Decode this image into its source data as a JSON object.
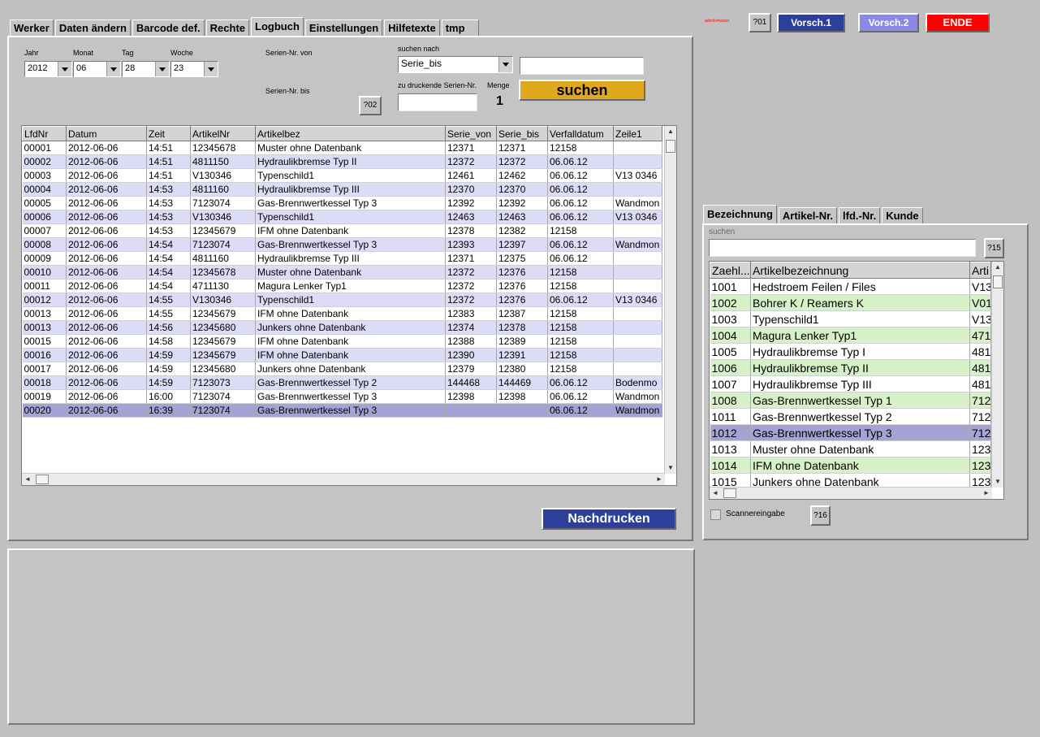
{
  "main_tabs": [
    "Werker",
    "Daten ändern",
    "Barcode def.",
    "Rechte",
    "Logbuch",
    "Einstellungen",
    "Hilfetexte",
    "tmp"
  ],
  "active_main_tab": "Logbuch",
  "top_bar": {
    "tiny_text": "admin/master",
    "btn_q01": "?01",
    "btn_vorsch1": "Vorsch.1",
    "btn_vorsch2": "Vorsch.2",
    "btn_ende": "ENDE"
  },
  "colors": {
    "vorsch1_bg": "#2c3f9a",
    "vorsch2_bg": "#8a8ae6",
    "ende_bg": "#ff0000",
    "suchen_bg": "#e0a81c",
    "nachdrucken_bg": "#2c3f9a",
    "row_alt_log": "#dcdcf6",
    "row_selected": "#a4a4d4",
    "row_alt_right": "#d6f0c8"
  },
  "date_filter": {
    "jahr_label": "Jahr",
    "jahr_value": "2012",
    "monat_label": "Monat",
    "monat_value": "06",
    "tag_label": "Tag",
    "tag_value": "28",
    "woche_label": "Woche",
    "woche_value": "23"
  },
  "search": {
    "serien_von_label": "Serien-Nr. von",
    "serien_bis_label": "Serien-Nr. bis",
    "btn_q02": "?02",
    "suchen_nach_label": "suchen nach",
    "suchen_nach_value": "Serie_bis",
    "search_value": "",
    "zu_druckende_label": "zu druckende Serien-Nr.",
    "zu_druckende_value": "",
    "menge_label": "Menge",
    "menge_value": "1",
    "suchen_button": "suchen"
  },
  "log_table": {
    "columns": [
      "LfdNr",
      "Datum",
      "Zeit",
      "ArtikelNr",
      "Artikelbez",
      "Serie_von",
      "Serie_bis",
      "Verfalldatum",
      "Zeile1"
    ],
    "rows": [
      [
        "00001",
        "2012-06-06",
        "14:51",
        "12345678",
        "Muster ohne Datenbank",
        "12371",
        "12371",
        "12158",
        ""
      ],
      [
        "00002",
        "2012-06-06",
        "14:51",
        "4811150",
        "Hydraulikbremse Typ II",
        "12372",
        "12372",
        "06.06.12",
        ""
      ],
      [
        "00003",
        "2012-06-06",
        "14:51",
        "V130346",
        "Typenschild1",
        "12461",
        "12462",
        "06.06.12",
        "V13 0346"
      ],
      [
        "00004",
        "2012-06-06",
        "14:53",
        "4811160",
        "Hydraulikbremse Typ III",
        "12370",
        "12370",
        "06.06.12",
        ""
      ],
      [
        "00005",
        "2012-06-06",
        "14:53",
        "7123074",
        "Gas-Brennwertkessel Typ 3",
        "12392",
        "12392",
        "06.06.12",
        "Wandmon"
      ],
      [
        "00006",
        "2012-06-06",
        "14:53",
        "V130346",
        "Typenschild1",
        "12463",
        "12463",
        "06.06.12",
        "V13 0346"
      ],
      [
        "00007",
        "2012-06-06",
        "14:53",
        "12345679",
        "IFM ohne Datenbank",
        "12378",
        "12382",
        "12158",
        ""
      ],
      [
        "00008",
        "2012-06-06",
        "14:54",
        "7123074",
        "Gas-Brennwertkessel Typ 3",
        "12393",
        "12397",
        "06.06.12",
        "Wandmon"
      ],
      [
        "00009",
        "2012-06-06",
        "14:54",
        "4811160",
        "Hydraulikbremse Typ III",
        "12371",
        "12375",
        "06.06.12",
        ""
      ],
      [
        "00010",
        "2012-06-06",
        "14:54",
        "12345678",
        "Muster ohne Datenbank",
        "12372",
        "12376",
        "12158",
        ""
      ],
      [
        "00011",
        "2012-06-06",
        "14:54",
        "4711130",
        "Magura Lenker Typ1",
        "12372",
        "12376",
        "12158",
        ""
      ],
      [
        "00012",
        "2012-06-06",
        "14:55",
        "V130346",
        "Typenschild1",
        "12372",
        "12376",
        "06.06.12",
        "V13 0346"
      ],
      [
        "00013",
        "2012-06-06",
        "14:55",
        "12345679",
        "IFM ohne Datenbank",
        "12383",
        "12387",
        "12158",
        ""
      ],
      [
        "00013",
        "2012-06-06",
        "14:56",
        "12345680",
        "Junkers ohne Datenbank",
        "12374",
        "12378",
        "12158",
        ""
      ],
      [
        "00015",
        "2012-06-06",
        "14:58",
        "12345679",
        "IFM ohne Datenbank",
        "12388",
        "12389",
        "12158",
        ""
      ],
      [
        "00016",
        "2012-06-06",
        "14:59",
        "12345679",
        "IFM ohne Datenbank",
        "12390",
        "12391",
        "12158",
        ""
      ],
      [
        "00017",
        "2012-06-06",
        "14:59",
        "12345680",
        "Junkers ohne Datenbank",
        "12379",
        "12380",
        "12158",
        ""
      ],
      [
        "00018",
        "2012-06-06",
        "14:59",
        "7123073",
        "Gas-Brennwertkessel Typ 2",
        "144468",
        "144469",
        "06.06.12",
        "Bodenmo"
      ],
      [
        "00019",
        "2012-06-06",
        "16:00",
        "7123074",
        "Gas-Brennwertkessel Typ 3",
        "12398",
        "12398",
        "06.06.12",
        "Wandmon"
      ],
      [
        "00020",
        "2012-06-06",
        "16:39",
        "7123074",
        "Gas-Brennwertkessel Typ 3",
        "",
        "",
        "06.06.12",
        "Wandmon"
      ]
    ],
    "selected_row": 19
  },
  "nachdrucken_button": "Nachdrucken",
  "right_panel": {
    "tabs": [
      "Bezeichnung",
      "Artikel-Nr.",
      "lfd.-Nr.",
      "Kunde"
    ],
    "active_tab": "Bezeichnung",
    "suchen_label": "suchen",
    "suchen_value": "",
    "btn_q15": "?15",
    "columns": [
      "Zaehl...",
      "Artikelbezeichnung",
      "Arti"
    ],
    "rows": [
      [
        "1001",
        "Hedstroem Feilen / Files",
        "V13"
      ],
      [
        "1002",
        "Bohrer K / Reamers K",
        "V01"
      ],
      [
        "1003",
        "Typenschild1",
        "V13"
      ],
      [
        "1004",
        "Magura Lenker Typ1",
        "471"
      ],
      [
        "1005",
        "Hydraulikbremse Typ I",
        "481"
      ],
      [
        "1006",
        "Hydraulikbremse Typ II",
        "481"
      ],
      [
        "1007",
        "Hydraulikbremse Typ III",
        "481"
      ],
      [
        "1008",
        "Gas-Brennwertkessel Typ 1",
        "712"
      ],
      [
        "1011",
        "Gas-Brennwertkessel Typ 2",
        "712"
      ],
      [
        "1012",
        "Gas-Brennwertkessel Typ 3",
        "712"
      ],
      [
        "1013",
        "Muster ohne Datenbank",
        "123"
      ],
      [
        "1014",
        "IFM ohne Datenbank",
        "123"
      ],
      [
        "1015",
        "Junkers ohne Datenbank",
        "123"
      ]
    ],
    "selected_row": 9,
    "scannereingabe_label": "Scannereingabe",
    "btn_q16": "?16"
  }
}
